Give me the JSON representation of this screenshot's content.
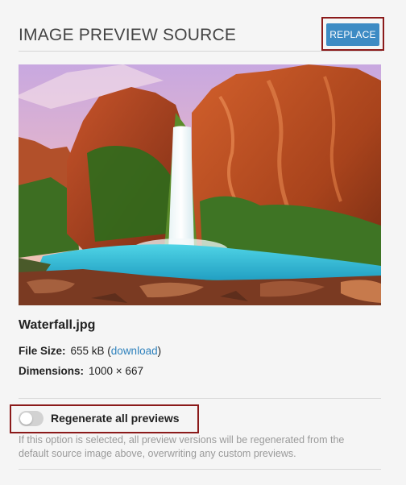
{
  "header": {
    "title": "IMAGE PREVIEW SOURCE",
    "replace_label": "REPLACE"
  },
  "colors": {
    "accent": "#3d8bc4",
    "highlight_outline": "#8b1a1a",
    "link": "#2f82bd"
  },
  "image": {
    "filename": "Waterfall.jpg",
    "file_size_label": "File Size:",
    "file_size_value": "655 kB",
    "download_label": "download",
    "dimensions_label": "Dimensions:",
    "dimensions_value": "1000 × 667"
  },
  "regenerate": {
    "label": "Regenerate all previews",
    "enabled": false,
    "help_text": "If this option is selected, all preview versions will be regenerated from the default source image above, overwriting any custom previews."
  }
}
